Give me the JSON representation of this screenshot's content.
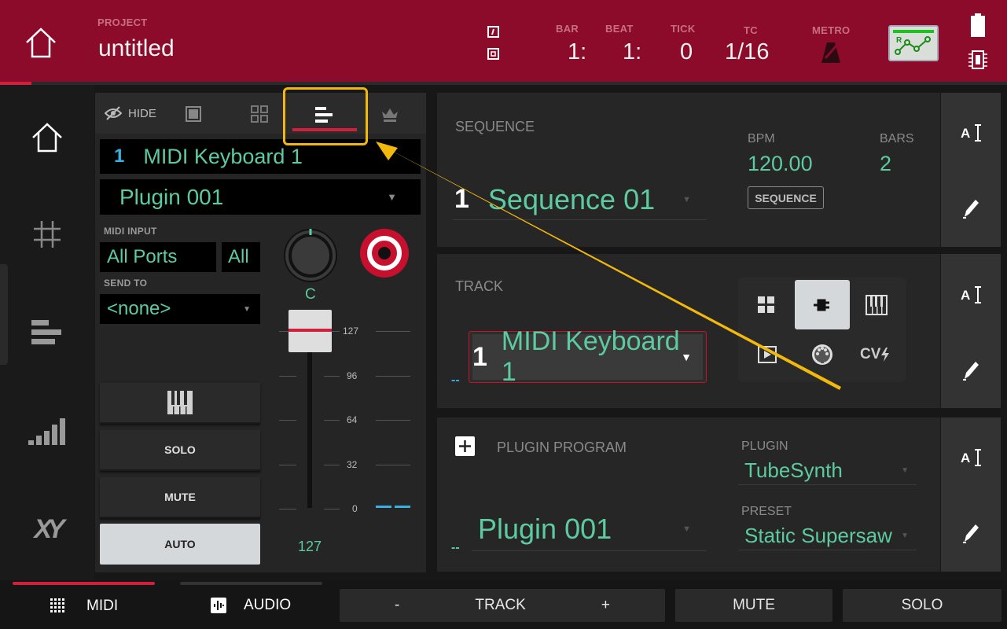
{
  "header": {
    "project_label": "PROJECT",
    "project_name": "untitled",
    "bar_label": "BAR",
    "bar_value": "1:",
    "beat_label": "BEAT",
    "beat_value": "1:",
    "tick_label": "TICK",
    "tick_value": "0",
    "tc_label": "TC",
    "tc_value": "1/16",
    "metro_label": "METRO",
    "automation_badge": "R"
  },
  "sidebar": {
    "items": [
      "home-icon",
      "pad-grid-icon",
      "track-view-icon",
      "mixer-icon",
      "xy-icon"
    ]
  },
  "left_panel": {
    "tabs": {
      "hide_label": "HIDE"
    },
    "track_number": "1",
    "track_name": "MIDI Keyboard 1",
    "program_name": "Plugin 001",
    "midi_input_label": "MIDI INPUT",
    "midi_input_port": "All Ports",
    "midi_input_channel": "All",
    "send_to_label": "SEND TO",
    "send_to_value": "<none>",
    "pan_value": "C",
    "fader_ticks": [
      "127",
      "96",
      "64",
      "32",
      "0"
    ],
    "fader_value": "127",
    "buttons": {
      "solo": "SOLO",
      "mute": "MUTE",
      "auto": "AUTO"
    }
  },
  "sequence_panel": {
    "label": "SEQUENCE",
    "number": "1",
    "name": "Sequence 01",
    "bpm_label": "BPM",
    "bpm_value": "120.00",
    "bars_label": "BARS",
    "bars_value": "2",
    "tempo_source_button": "SEQUENCE"
  },
  "track_panel": {
    "label": "TRACK",
    "number": "1",
    "name": "MIDI Keyboard 1",
    "marker": "--",
    "type_buttons": {
      "cv_label": "CV"
    }
  },
  "plugin_panel": {
    "label": "PLUGIN PROGRAM",
    "name": "Plugin 001",
    "marker": "--",
    "plugin_label": "PLUGIN",
    "plugin_value": "TubeSynth",
    "preset_label": "PRESET",
    "preset_value": "Static Supersaw"
  },
  "bottom_bar": {
    "midi": "MIDI",
    "audio": "AUDIO",
    "track_minus": "-",
    "track": "TRACK",
    "track_plus": "+",
    "mute": "MUTE",
    "solo": "SOLO"
  },
  "colors": {
    "header_bg": "#8c0a2a",
    "accent_teal": "#5dcba1",
    "accent_red": "#d11f3c",
    "callout": "#f2b80c"
  }
}
